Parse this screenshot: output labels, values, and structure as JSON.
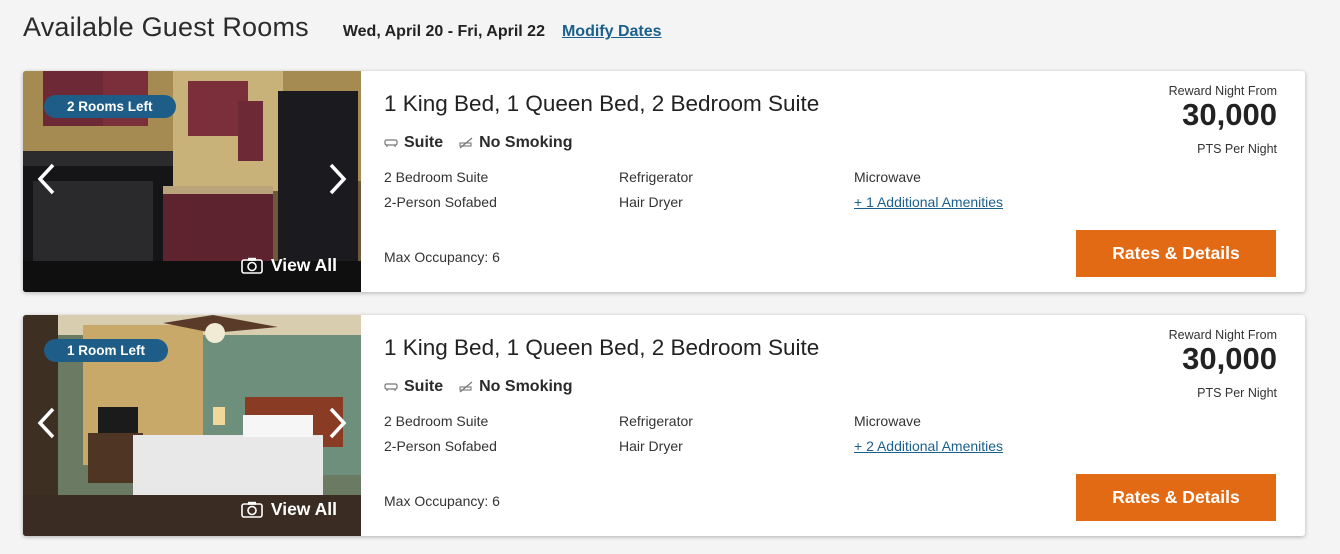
{
  "header": {
    "title": "Available Guest Rooms",
    "dates": "Wed, April 20 - Fri, April 22",
    "modify_label": "Modify Dates"
  },
  "rooms": [
    {
      "availability": "2 Rooms Left",
      "view_all": "View All",
      "title": "1 King Bed, 1 Queen Bed, 2 Bedroom Suite",
      "tags": [
        "Suite",
        "No Smoking"
      ],
      "amenities": [
        [
          "2 Bedroom Suite",
          "Refrigerator",
          "Microwave"
        ],
        [
          "2-Person Sofabed",
          "Hair Dryer",
          "+ 1 Additional Amenities"
        ]
      ],
      "max_occupancy": "Max Occupancy: 6",
      "reward_label": "Reward Night From",
      "points": "30,000",
      "per_night": "PTS Per Night",
      "button": "Rates & Details",
      "photo_subject": "kitchen"
    },
    {
      "availability": "1 Room Left",
      "view_all": "View All",
      "title": "1 King Bed, 1 Queen Bed, 2 Bedroom Suite",
      "tags": [
        "Suite",
        "No Smoking"
      ],
      "amenities": [
        [
          "2 Bedroom Suite",
          "Refrigerator",
          "Microwave"
        ],
        [
          "2-Person Sofabed",
          "Hair Dryer",
          "+ 2 Additional Amenities"
        ]
      ],
      "max_occupancy": "Max Occupancy: 6",
      "reward_label": "Reward Night From",
      "points": "30,000",
      "per_night": "PTS Per Night",
      "button": "Rates & Details",
      "photo_subject": "bedroom"
    }
  ],
  "colors": {
    "accent_button": "#e36a14",
    "badge": "#1e5d87",
    "link": "#1b5f8c"
  },
  "icons": [
    "chevron-left-icon",
    "chevron-right-icon",
    "camera-icon",
    "sofa-icon",
    "no-smoking-icon"
  ]
}
